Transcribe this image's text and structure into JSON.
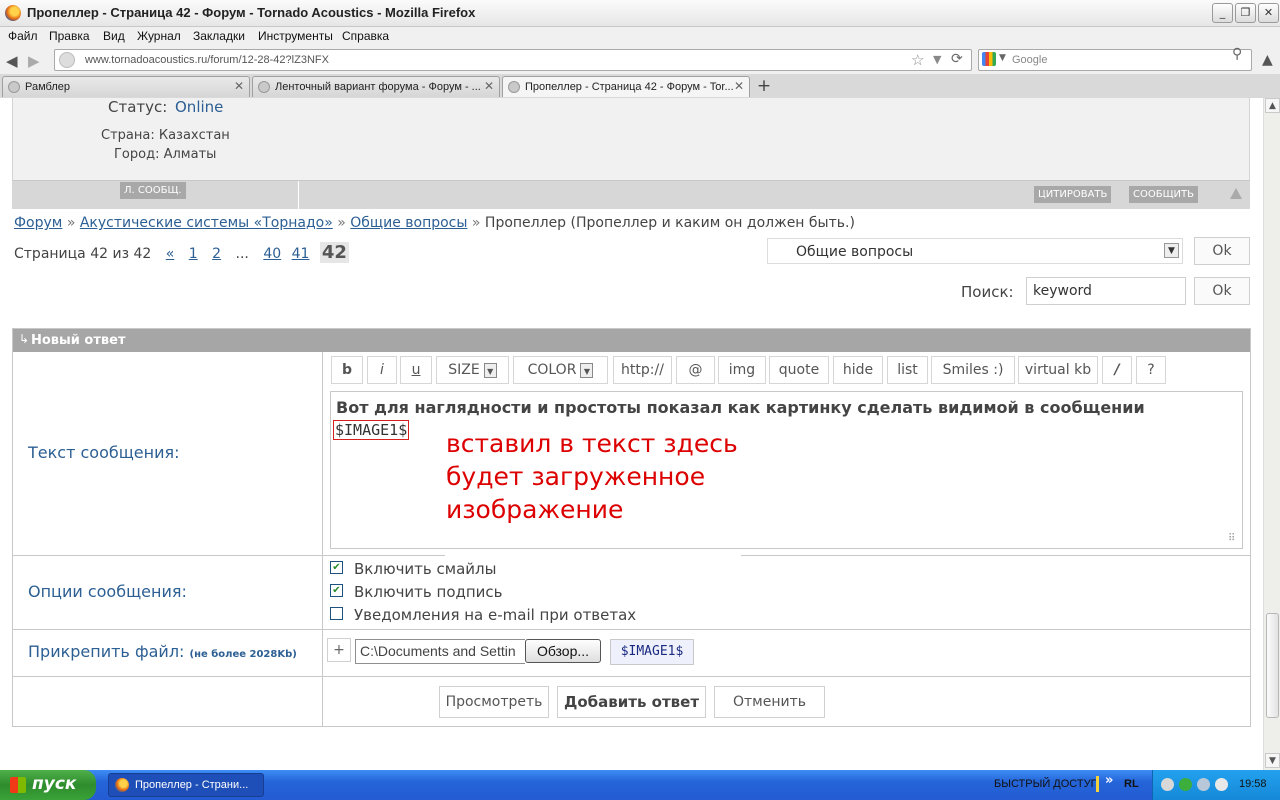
{
  "window": {
    "title": "Пропеллер - Страница 42 - Форум - Tornado Acoustics - Mozilla Firefox"
  },
  "menu": [
    "Файл",
    "Правка",
    "Вид",
    "Журнал",
    "Закладки",
    "Инструменты",
    "Справка"
  ],
  "navbar": {
    "url": "www.tornadoacoustics.ru/forum/12-28-42?lZ3NFX",
    "search_placeholder": "Google"
  },
  "tabs": [
    {
      "label": "Рамблер",
      "active": false
    },
    {
      "label": "Ленточный вариант форума - Форум - ...",
      "active": false
    },
    {
      "label": "Пропеллер - Страница 42 - Форум - Tor...",
      "active": true
    }
  ],
  "profile": {
    "status_label": "Статус:",
    "status_value": "Online",
    "country": "Страна: Казахстан",
    "city": "Город: Алматы",
    "pm_button": "Л. СООБЩ.",
    "quote_button": "ЦИТИРОВАТЬ",
    "report_button": "СООБЩИТЬ"
  },
  "breadcrumb": {
    "forum": "Форум",
    "section": "Акустические системы «Торнадо»",
    "subsection": "Общие вопросы",
    "current": "Пропеллер (Пропеллер и каким он должен быть.)",
    "sep": "»"
  },
  "pager": {
    "label": "Страница 42 из 42",
    "prev": "«",
    "pages": [
      "1",
      "2"
    ],
    "ellipsis": "...",
    "pages_end": [
      "40",
      "41"
    ],
    "current": "42"
  },
  "forum_jump": {
    "selected": "Общие вопросы",
    "ok": "Ok"
  },
  "search": {
    "label": "Поиск:",
    "value": "keyword",
    "ok": "Ok"
  },
  "reply": {
    "header": "Новый ответ",
    "text_label": "Текст сообщения:",
    "options_label": "Опции сообщения:",
    "attach_label": "Прикрепить файл:",
    "attach_note": "(не более 2028Kb)",
    "toolbar": {
      "b": "b",
      "i": "i",
      "u": "u",
      "size": "SIZE",
      "color": "COLOR",
      "http": "http://",
      "at": "@",
      "img": "img",
      "quote": "quote",
      "hide": "hide",
      "list": "list",
      "smiles": "Smiles :)",
      "vkb": "virtual kb",
      "slash": "/",
      "help": "?"
    },
    "message_text": "Вот для наглядности и простоты показал как картинку сделать видимой в сообщении",
    "message_tag": "$IMAGE1$",
    "annotation": [
      "вставил в текст здесь",
      "будет загруженное",
      "изображение"
    ],
    "options": [
      {
        "label": "Включить смайлы",
        "checked": true
      },
      {
        "label": "Включить подпись",
        "checked": true
      },
      {
        "label": "Уведомления на e-mail при ответах",
        "checked": false
      }
    ],
    "attach_plus": "+",
    "file_path": "C:\\Documents and Settin",
    "browse": "Обзор...",
    "image_tag": "$IMAGE1$",
    "preview": "Просмотреть",
    "submit": "Добавить ответ",
    "cancel": "Отменить"
  },
  "taskbar": {
    "start": "пуск",
    "task": "Пропеллер - Страни...",
    "quick_access": "БЫСТРЫЙ ДОСТУП",
    "chevron": "»",
    "lang": "RL",
    "clock": "19:58"
  },
  "colors": {
    "link": "#2c5f93",
    "annotation": "#dd0000",
    "header_gray": "#a6a6a6",
    "taskbar_blue": "#245bd4"
  }
}
